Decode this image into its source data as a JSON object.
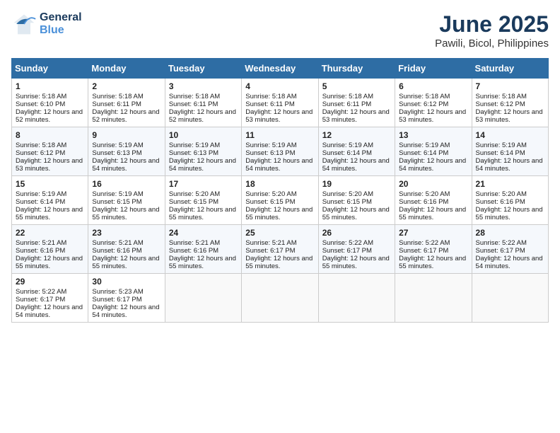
{
  "header": {
    "logo_general": "General",
    "logo_blue": "Blue",
    "month": "June 2025",
    "location": "Pawili, Bicol, Philippines"
  },
  "columns": [
    "Sunday",
    "Monday",
    "Tuesday",
    "Wednesday",
    "Thursday",
    "Friday",
    "Saturday"
  ],
  "weeks": [
    [
      {
        "day": "1",
        "sunrise": "Sunrise: 5:18 AM",
        "sunset": "Sunset: 6:10 PM",
        "daylight": "Daylight: 12 hours and 52 minutes."
      },
      {
        "day": "2",
        "sunrise": "Sunrise: 5:18 AM",
        "sunset": "Sunset: 6:11 PM",
        "daylight": "Daylight: 12 hours and 52 minutes."
      },
      {
        "day": "3",
        "sunrise": "Sunrise: 5:18 AM",
        "sunset": "Sunset: 6:11 PM",
        "daylight": "Daylight: 12 hours and 52 minutes."
      },
      {
        "day": "4",
        "sunrise": "Sunrise: 5:18 AM",
        "sunset": "Sunset: 6:11 PM",
        "daylight": "Daylight: 12 hours and 53 minutes."
      },
      {
        "day": "5",
        "sunrise": "Sunrise: 5:18 AM",
        "sunset": "Sunset: 6:11 PM",
        "daylight": "Daylight: 12 hours and 53 minutes."
      },
      {
        "day": "6",
        "sunrise": "Sunrise: 5:18 AM",
        "sunset": "Sunset: 6:12 PM",
        "daylight": "Daylight: 12 hours and 53 minutes."
      },
      {
        "day": "7",
        "sunrise": "Sunrise: 5:18 AM",
        "sunset": "Sunset: 6:12 PM",
        "daylight": "Daylight: 12 hours and 53 minutes."
      }
    ],
    [
      {
        "day": "8",
        "sunrise": "Sunrise: 5:18 AM",
        "sunset": "Sunset: 6:12 PM",
        "daylight": "Daylight: 12 hours and 53 minutes."
      },
      {
        "day": "9",
        "sunrise": "Sunrise: 5:19 AM",
        "sunset": "Sunset: 6:13 PM",
        "daylight": "Daylight: 12 hours and 54 minutes."
      },
      {
        "day": "10",
        "sunrise": "Sunrise: 5:19 AM",
        "sunset": "Sunset: 6:13 PM",
        "daylight": "Daylight: 12 hours and 54 minutes."
      },
      {
        "day": "11",
        "sunrise": "Sunrise: 5:19 AM",
        "sunset": "Sunset: 6:13 PM",
        "daylight": "Daylight: 12 hours and 54 minutes."
      },
      {
        "day": "12",
        "sunrise": "Sunrise: 5:19 AM",
        "sunset": "Sunset: 6:14 PM",
        "daylight": "Daylight: 12 hours and 54 minutes."
      },
      {
        "day": "13",
        "sunrise": "Sunrise: 5:19 AM",
        "sunset": "Sunset: 6:14 PM",
        "daylight": "Daylight: 12 hours and 54 minutes."
      },
      {
        "day": "14",
        "sunrise": "Sunrise: 5:19 AM",
        "sunset": "Sunset: 6:14 PM",
        "daylight": "Daylight: 12 hours and 54 minutes."
      }
    ],
    [
      {
        "day": "15",
        "sunrise": "Sunrise: 5:19 AM",
        "sunset": "Sunset: 6:14 PM",
        "daylight": "Daylight: 12 hours and 55 minutes."
      },
      {
        "day": "16",
        "sunrise": "Sunrise: 5:19 AM",
        "sunset": "Sunset: 6:15 PM",
        "daylight": "Daylight: 12 hours and 55 minutes."
      },
      {
        "day": "17",
        "sunrise": "Sunrise: 5:20 AM",
        "sunset": "Sunset: 6:15 PM",
        "daylight": "Daylight: 12 hours and 55 minutes."
      },
      {
        "day": "18",
        "sunrise": "Sunrise: 5:20 AM",
        "sunset": "Sunset: 6:15 PM",
        "daylight": "Daylight: 12 hours and 55 minutes."
      },
      {
        "day": "19",
        "sunrise": "Sunrise: 5:20 AM",
        "sunset": "Sunset: 6:15 PM",
        "daylight": "Daylight: 12 hours and 55 minutes."
      },
      {
        "day": "20",
        "sunrise": "Sunrise: 5:20 AM",
        "sunset": "Sunset: 6:16 PM",
        "daylight": "Daylight: 12 hours and 55 minutes."
      },
      {
        "day": "21",
        "sunrise": "Sunrise: 5:20 AM",
        "sunset": "Sunset: 6:16 PM",
        "daylight": "Daylight: 12 hours and 55 minutes."
      }
    ],
    [
      {
        "day": "22",
        "sunrise": "Sunrise: 5:21 AM",
        "sunset": "Sunset: 6:16 PM",
        "daylight": "Daylight: 12 hours and 55 minutes."
      },
      {
        "day": "23",
        "sunrise": "Sunrise: 5:21 AM",
        "sunset": "Sunset: 6:16 PM",
        "daylight": "Daylight: 12 hours and 55 minutes."
      },
      {
        "day": "24",
        "sunrise": "Sunrise: 5:21 AM",
        "sunset": "Sunset: 6:16 PM",
        "daylight": "Daylight: 12 hours and 55 minutes."
      },
      {
        "day": "25",
        "sunrise": "Sunrise: 5:21 AM",
        "sunset": "Sunset: 6:17 PM",
        "daylight": "Daylight: 12 hours and 55 minutes."
      },
      {
        "day": "26",
        "sunrise": "Sunrise: 5:22 AM",
        "sunset": "Sunset: 6:17 PM",
        "daylight": "Daylight: 12 hours and 55 minutes."
      },
      {
        "day": "27",
        "sunrise": "Sunrise: 5:22 AM",
        "sunset": "Sunset: 6:17 PM",
        "daylight": "Daylight: 12 hours and 55 minutes."
      },
      {
        "day": "28",
        "sunrise": "Sunrise: 5:22 AM",
        "sunset": "Sunset: 6:17 PM",
        "daylight": "Daylight: 12 hours and 54 minutes."
      }
    ],
    [
      {
        "day": "29",
        "sunrise": "Sunrise: 5:22 AM",
        "sunset": "Sunset: 6:17 PM",
        "daylight": "Daylight: 12 hours and 54 minutes."
      },
      {
        "day": "30",
        "sunrise": "Sunrise: 5:23 AM",
        "sunset": "Sunset: 6:17 PM",
        "daylight": "Daylight: 12 hours and 54 minutes."
      },
      null,
      null,
      null,
      null,
      null
    ]
  ]
}
